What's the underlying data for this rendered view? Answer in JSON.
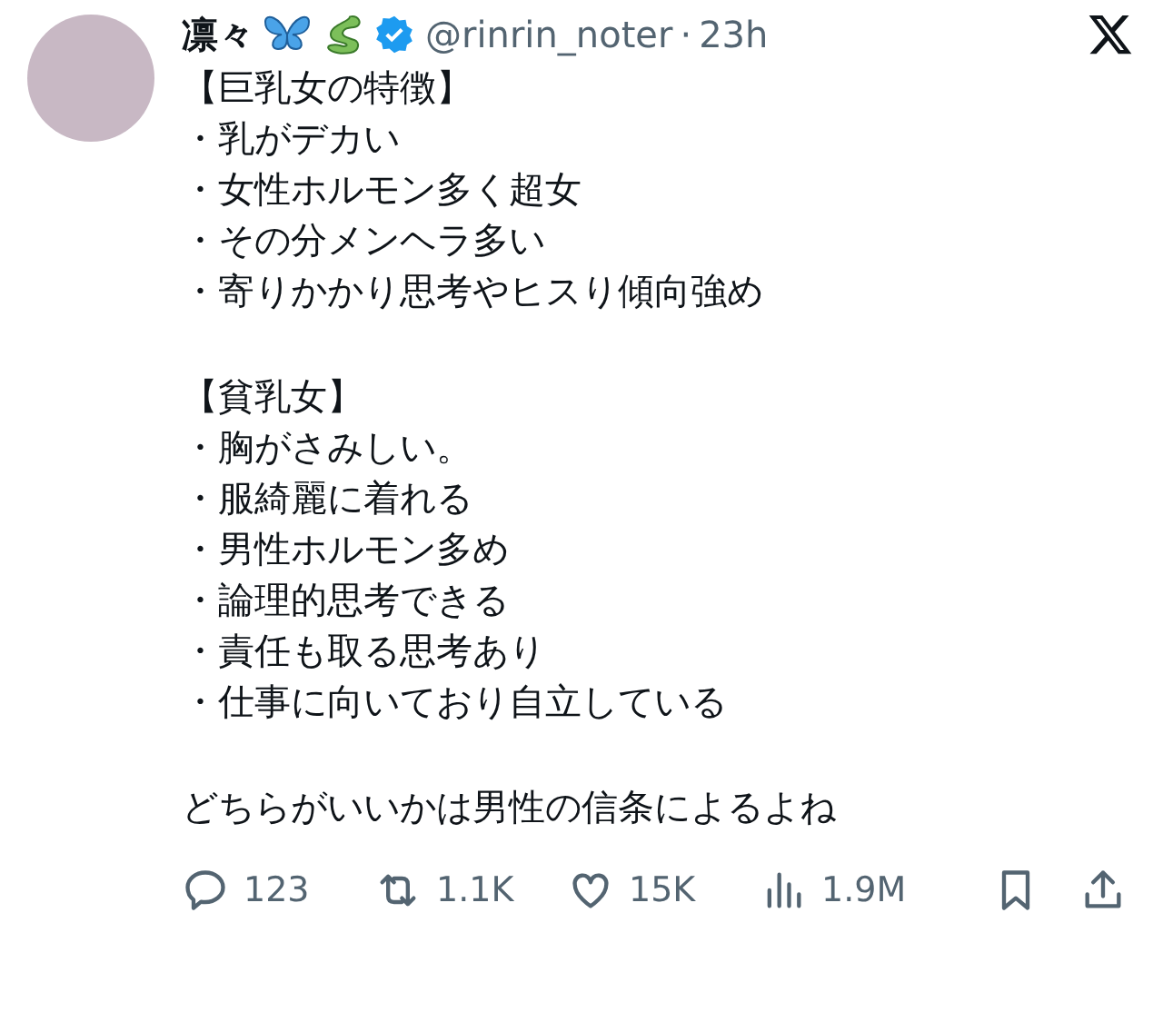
{
  "author": {
    "name": "凛々",
    "handle": "@rinrin_noter",
    "separator": "·",
    "time": "23h",
    "verified": true
  },
  "body": [
    {
      "lines": [
        "【巨乳女の特徴】",
        "・乳がデカい",
        "・女性ホルモン多く超女",
        "・その分メンヘラ多い",
        "・寄りかかり思考やヒスり傾向強め"
      ]
    },
    {
      "lines": [
        "【貧乳女】",
        "・胸がさみしい。",
        "・服綺麗に着れる",
        "・男性ホルモン多め",
        "・論理的思考できる",
        "・責任も取る思考あり",
        "・仕事に向いており自立している"
      ]
    },
    {
      "lines": [
        "どちらがいいかは男性の信条によるよね"
      ]
    }
  ],
  "actions": [
    {
      "kind": "reply",
      "count": "123"
    },
    {
      "kind": "repost",
      "count": "1.1K"
    },
    {
      "kind": "like",
      "count": "15K"
    },
    {
      "kind": "views",
      "count": "1.9M"
    },
    {
      "kind": "bookmark"
    },
    {
      "kind": "share"
    }
  ]
}
